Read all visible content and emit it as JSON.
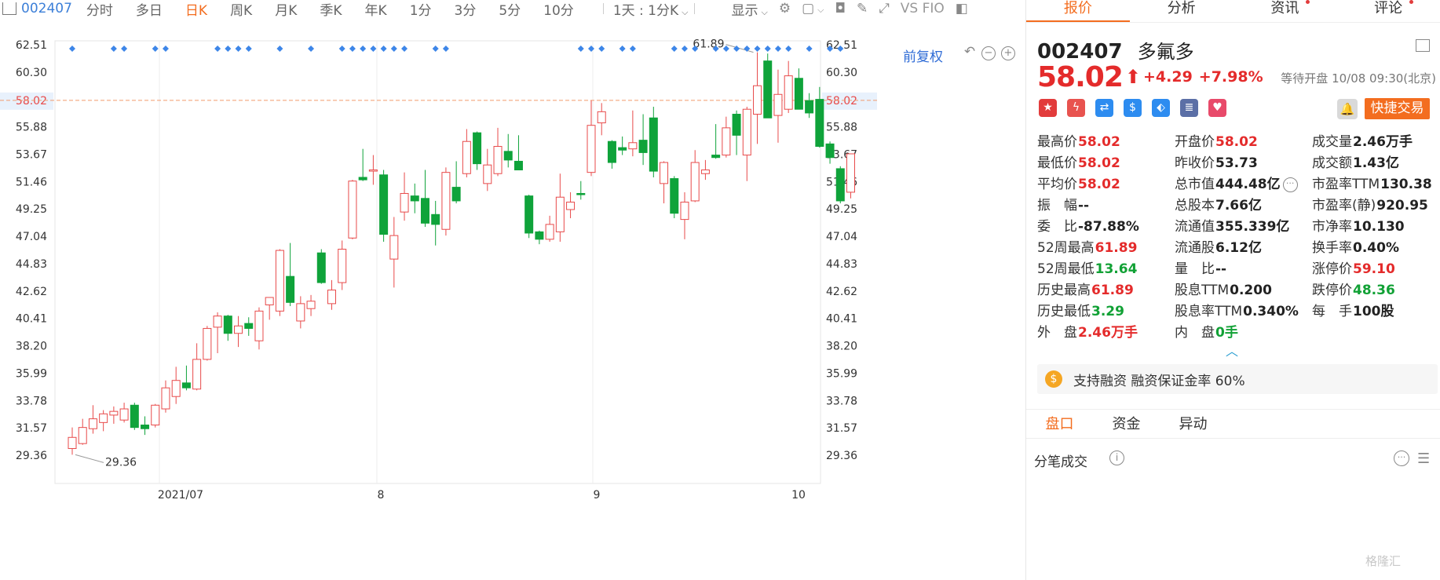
{
  "toolbar": {
    "code": "002407",
    "periods": [
      "分时",
      "多日",
      "日K",
      "周K",
      "月K",
      "季K",
      "年K",
      "1分",
      "3分",
      "5分",
      "10分"
    ],
    "active_period": "日K",
    "interval_select": "1天 : 1分K",
    "display_label": "显示",
    "indicator_label": "VS FIO"
  },
  "chart": {
    "fuquan_label": "前复权",
    "price_labels": [
      "62.51",
      "60.30",
      "58.02",
      "55.88",
      "53.67",
      "51.46",
      "49.25",
      "47.04",
      "44.83",
      "42.62",
      "40.41",
      "38.20",
      "35.99",
      "33.78",
      "31.57",
      "29.36"
    ],
    "current_price_label": "58.02",
    "high_label": "61.89",
    "low_label": "29.36",
    "date_labels": [
      "2021/07",
      "8",
      "9",
      "10"
    ],
    "colors": {
      "up": "#e84a4a",
      "down": "#0fa33a",
      "dash": "#f29a6c",
      "marker": "#3d86e8"
    }
  },
  "chart_data": {
    "type": "candlestick",
    "ylim": [
      28.5,
      63.5
    ],
    "current_price": 58.02,
    "high_label": 61.89,
    "low_label": 29.36,
    "x_ticks": [
      "2021/07",
      "8",
      "9",
      "10"
    ],
    "candles": [
      {
        "o": 29.9,
        "h": 31.6,
        "l": 29.4,
        "c": 30.8
      },
      {
        "o": 30.3,
        "h": 32.3,
        "l": 30.2,
        "c": 31.6
      },
      {
        "o": 31.5,
        "h": 33.4,
        "l": 31.1,
        "c": 32.3
      },
      {
        "o": 32.0,
        "h": 33.0,
        "l": 31.3,
        "c": 32.7
      },
      {
        "o": 32.6,
        "h": 33.3,
        "l": 31.9,
        "c": 32.9
      },
      {
        "o": 32.2,
        "h": 33.6,
        "l": 32.0,
        "c": 33.1
      },
      {
        "o": 33.4,
        "h": 33.6,
        "l": 31.4,
        "c": 31.6
      },
      {
        "o": 31.8,
        "h": 32.5,
        "l": 31.0,
        "c": 31.5
      },
      {
        "o": 31.8,
        "h": 33.5,
        "l": 31.6,
        "c": 33.4
      },
      {
        "o": 33.1,
        "h": 35.4,
        "l": 32.8,
        "c": 34.8
      },
      {
        "o": 34.1,
        "h": 36.5,
        "l": 33.5,
        "c": 35.4
      },
      {
        "o": 35.2,
        "h": 36.6,
        "l": 34.6,
        "c": 34.8
      },
      {
        "o": 34.7,
        "h": 38.4,
        "l": 34.6,
        "c": 37.1
      },
      {
        "o": 37.1,
        "h": 39.8,
        "l": 37.0,
        "c": 39.6
      },
      {
        "o": 39.7,
        "h": 40.9,
        "l": 37.6,
        "c": 40.6
      },
      {
        "o": 40.6,
        "h": 40.7,
        "l": 38.6,
        "c": 39.2
      },
      {
        "o": 39.2,
        "h": 40.6,
        "l": 38.1,
        "c": 39.8
      },
      {
        "o": 40.0,
        "h": 40.5,
        "l": 39.0,
        "c": 39.6
      },
      {
        "o": 38.6,
        "h": 41.3,
        "l": 37.9,
        "c": 41.0
      },
      {
        "o": 41.5,
        "h": 41.7,
        "l": 40.3,
        "c": 42.1
      },
      {
        "o": 41.0,
        "h": 46.0,
        "l": 40.6,
        "c": 45.9
      },
      {
        "o": 43.8,
        "h": 46.5,
        "l": 41.4,
        "c": 41.7
      },
      {
        "o": 40.2,
        "h": 42.2,
        "l": 39.6,
        "c": 41.6
      },
      {
        "o": 41.2,
        "h": 42.3,
        "l": 40.6,
        "c": 41.8
      },
      {
        "o": 45.7,
        "h": 46.0,
        "l": 43.2,
        "c": 43.3
      },
      {
        "o": 41.6,
        "h": 43.5,
        "l": 41.1,
        "c": 42.7
      },
      {
        "o": 43.3,
        "h": 46.7,
        "l": 42.7,
        "c": 46.0
      },
      {
        "o": 46.9,
        "h": 51.6,
        "l": 46.8,
        "c": 51.5
      },
      {
        "o": 51.8,
        "h": 54.1,
        "l": 51.5,
        "c": 51.6
      },
      {
        "o": 52.3,
        "h": 53.6,
        "l": 51.2,
        "c": 52.4
      },
      {
        "o": 52.0,
        "h": 52.4,
        "l": 46.6,
        "c": 47.2
      },
      {
        "o": 45.2,
        "h": 48.6,
        "l": 42.9,
        "c": 47.1
      },
      {
        "o": 49.0,
        "h": 52.2,
        "l": 48.3,
        "c": 50.5
      },
      {
        "o": 50.3,
        "h": 51.3,
        "l": 48.9,
        "c": 49.9
      },
      {
        "o": 50.1,
        "h": 52.4,
        "l": 47.8,
        "c": 48.1
      },
      {
        "o": 48.8,
        "h": 49.9,
        "l": 46.3,
        "c": 48.0
      },
      {
        "o": 47.6,
        "h": 52.6,
        "l": 47.1,
        "c": 52.2
      },
      {
        "o": 51.0,
        "h": 53.1,
        "l": 49.7,
        "c": 49.9
      },
      {
        "o": 52.1,
        "h": 55.7,
        "l": 51.8,
        "c": 54.7
      },
      {
        "o": 55.4,
        "h": 55.5,
        "l": 52.4,
        "c": 52.9
      },
      {
        "o": 51.3,
        "h": 54.1,
        "l": 50.7,
        "c": 52.8
      },
      {
        "o": 52.1,
        "h": 55.8,
        "l": 51.9,
        "c": 54.3
      },
      {
        "o": 53.9,
        "h": 55.3,
        "l": 52.6,
        "c": 53.2
      },
      {
        "o": 53.1,
        "h": 55.2,
        "l": 52.4,
        "c": 52.4
      },
      {
        "o": 50.3,
        "h": 50.4,
        "l": 46.9,
        "c": 47.3
      },
      {
        "o": 47.4,
        "h": 47.5,
        "l": 46.4,
        "c": 46.8
      },
      {
        "o": 46.8,
        "h": 48.7,
        "l": 46.6,
        "c": 48.0
      },
      {
        "o": 47.4,
        "h": 52.1,
        "l": 46.6,
        "c": 50.2
      },
      {
        "o": 49.2,
        "h": 50.6,
        "l": 48.5,
        "c": 49.8
      },
      {
        "o": 50.5,
        "h": 51.5,
        "l": 50.0,
        "c": 50.4
      },
      {
        "o": 52.2,
        "h": 58.0,
        "l": 51.9,
        "c": 56.0
      },
      {
        "o": 56.2,
        "h": 57.8,
        "l": 55.2,
        "c": 57.1
      },
      {
        "o": 54.7,
        "h": 54.8,
        "l": 52.5,
        "c": 53.0
      },
      {
        "o": 54.2,
        "h": 55.1,
        "l": 53.6,
        "c": 54.0
      },
      {
        "o": 54.1,
        "h": 57.2,
        "l": 53.5,
        "c": 54.6
      },
      {
        "o": 54.8,
        "h": 56.9,
        "l": 52.8,
        "c": 53.8
      },
      {
        "o": 56.6,
        "h": 57.5,
        "l": 51.8,
        "c": 52.3
      },
      {
        "o": 51.3,
        "h": 53.1,
        "l": 49.7,
        "c": 53.0
      },
      {
        "o": 51.7,
        "h": 51.9,
        "l": 48.5,
        "c": 48.9
      },
      {
        "o": 48.4,
        "h": 50.6,
        "l": 46.8,
        "c": 49.8
      },
      {
        "o": 49.9,
        "h": 54.0,
        "l": 49.8,
        "c": 53.0
      },
      {
        "o": 52.1,
        "h": 53.2,
        "l": 51.6,
        "c": 52.4
      },
      {
        "o": 53.6,
        "h": 56.1,
        "l": 53.3,
        "c": 53.4
      },
      {
        "o": 53.6,
        "h": 56.7,
        "l": 53.4,
        "c": 55.8
      },
      {
        "o": 56.9,
        "h": 57.2,
        "l": 53.6,
        "c": 55.2
      },
      {
        "o": 53.6,
        "h": 57.5,
        "l": 51.5,
        "c": 57.3
      },
      {
        "o": 56.9,
        "h": 61.9,
        "l": 54.5,
        "c": 59.2
      },
      {
        "o": 61.2,
        "h": 61.8,
        "l": 56.7,
        "c": 56.6
      },
      {
        "o": 56.8,
        "h": 60.5,
        "l": 54.6,
        "c": 58.5
      },
      {
        "o": 57.3,
        "h": 61.2,
        "l": 57.0,
        "c": 60.0
      },
      {
        "o": 59.8,
        "h": 60.6,
        "l": 57.3,
        "c": 57.3
      },
      {
        "o": 58.0,
        "h": 58.6,
        "l": 56.6,
        "c": 57.0
      },
      {
        "o": 58.1,
        "h": 59.1,
        "l": 54.2,
        "c": 54.3
      },
      {
        "o": 54.5,
        "h": 54.7,
        "l": 52.9,
        "c": 53.4
      },
      {
        "o": 52.5,
        "h": 52.7,
        "l": 49.7,
        "c": 49.9
      },
      {
        "o": 50.6,
        "h": 53.7,
        "l": 50.1,
        "c": 53.7
      }
    ]
  },
  "panel": {
    "tabs": [
      "报价",
      "分析",
      "资讯",
      "评论"
    ],
    "active_tab": "报价",
    "code": "002407",
    "name": "多氟多",
    "price": "58.02",
    "change": "+4.29",
    "change_pct": "+7.98%",
    "status": "等待开盘 10/08 09:30(北京)",
    "quick_trade": "快捷交易",
    "icons": [
      "cn-flag-icon",
      "lightning-icon",
      "shuffle-icon",
      "dollar-icon",
      "tag-icon",
      "note-icon",
      "heart-icon"
    ],
    "grid": [
      {
        "label": "最高价",
        "value": "58.02",
        "color": "red"
      },
      {
        "label": "开盘价",
        "value": "58.02",
        "color": "red"
      },
      {
        "label": "成交量",
        "value": "2.46万手",
        "color": "dark"
      },
      {
        "label": "最低价",
        "value": "58.02",
        "color": "red"
      },
      {
        "label": "昨收价",
        "value": "53.73",
        "color": "dark"
      },
      {
        "label": "成交额",
        "value": "1.43亿",
        "color": "dark"
      },
      {
        "label": "平均价",
        "value": "58.02",
        "color": "red"
      },
      {
        "label": "总市值",
        "value": "444.48亿",
        "color": "dark",
        "more": true
      },
      {
        "label": "市盈率TTM",
        "value": "130.38",
        "color": "dark"
      },
      {
        "label": "振　幅",
        "value": "--",
        "color": "dark"
      },
      {
        "label": "总股本",
        "value": "7.66亿",
        "color": "dark"
      },
      {
        "label": "市盈率(静)",
        "value": "920.95",
        "color": "dark"
      },
      {
        "label": "委　比",
        "value": "-87.88%",
        "color": "dark"
      },
      {
        "label": "流通值",
        "value": "355.339亿",
        "color": "dark"
      },
      {
        "label": "市净率",
        "value": "10.130",
        "color": "dark"
      },
      {
        "label": "52周最高",
        "value": "61.89",
        "color": "red"
      },
      {
        "label": "流通股",
        "value": "6.12亿",
        "color": "dark"
      },
      {
        "label": "换手率",
        "value": "0.40%",
        "color": "dark"
      },
      {
        "label": "52周最低",
        "value": "13.64",
        "color": "green"
      },
      {
        "label": "量　比",
        "value": "--",
        "color": "dark"
      },
      {
        "label": "涨停价",
        "value": "59.10",
        "color": "red"
      },
      {
        "label": "历史最高",
        "value": "61.89",
        "color": "red"
      },
      {
        "label": "股息TTM",
        "value": "0.200",
        "color": "dark"
      },
      {
        "label": "跌停价",
        "value": "48.36",
        "color": "green"
      },
      {
        "label": "历史最低",
        "value": "3.29",
        "color": "green"
      },
      {
        "label": "股息率TTM",
        "value": "0.340%",
        "color": "dark"
      },
      {
        "label": "每　手",
        "value": "100股",
        "color": "dark"
      },
      {
        "label": "外　盘",
        "value": "2.46万手",
        "color": "red"
      },
      {
        "label": "内　盘",
        "value": "0手",
        "color": "green"
      },
      {
        "label": "",
        "value": "",
        "color": "dark"
      }
    ],
    "margin_text": "支持融资 融资保证金率 60%",
    "sub_tabs": [
      "盘口",
      "资金",
      "异动"
    ],
    "active_sub_tab": "盘口",
    "tick_title": "分笔成交",
    "watermark": "格隆汇"
  }
}
